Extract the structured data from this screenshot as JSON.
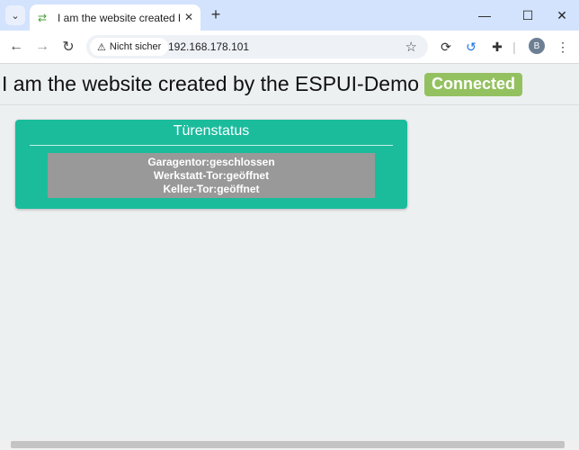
{
  "browser": {
    "tab_title": "I am the website created by the ESPUI-Demo",
    "new_tab_symbol": "+",
    "security_label": "Nicht sicher",
    "url": "192.168.178.101",
    "profile_initial": "B",
    "icons": {
      "tab_menu": "chevron-down-icon",
      "favicon": "arrows-swap-icon",
      "close": "close-icon",
      "back": "arrow-left-icon",
      "forward": "arrow-right-icon",
      "reload": "reload-icon",
      "warning": "warning-icon",
      "bookmark": "star-icon",
      "extensions": "puzzle-icon"
    }
  },
  "page": {
    "title": "I am the website created by the ESPUI-Demo",
    "status_badge": "Connected",
    "status_color": "#94c160"
  },
  "card": {
    "title": "Türenstatus",
    "color": "#1abc9c",
    "lines": [
      "Garagentor:geschlossen",
      "Werkstatt-Tor:geöffnet",
      "Keller-Tor:geöffnet"
    ]
  }
}
